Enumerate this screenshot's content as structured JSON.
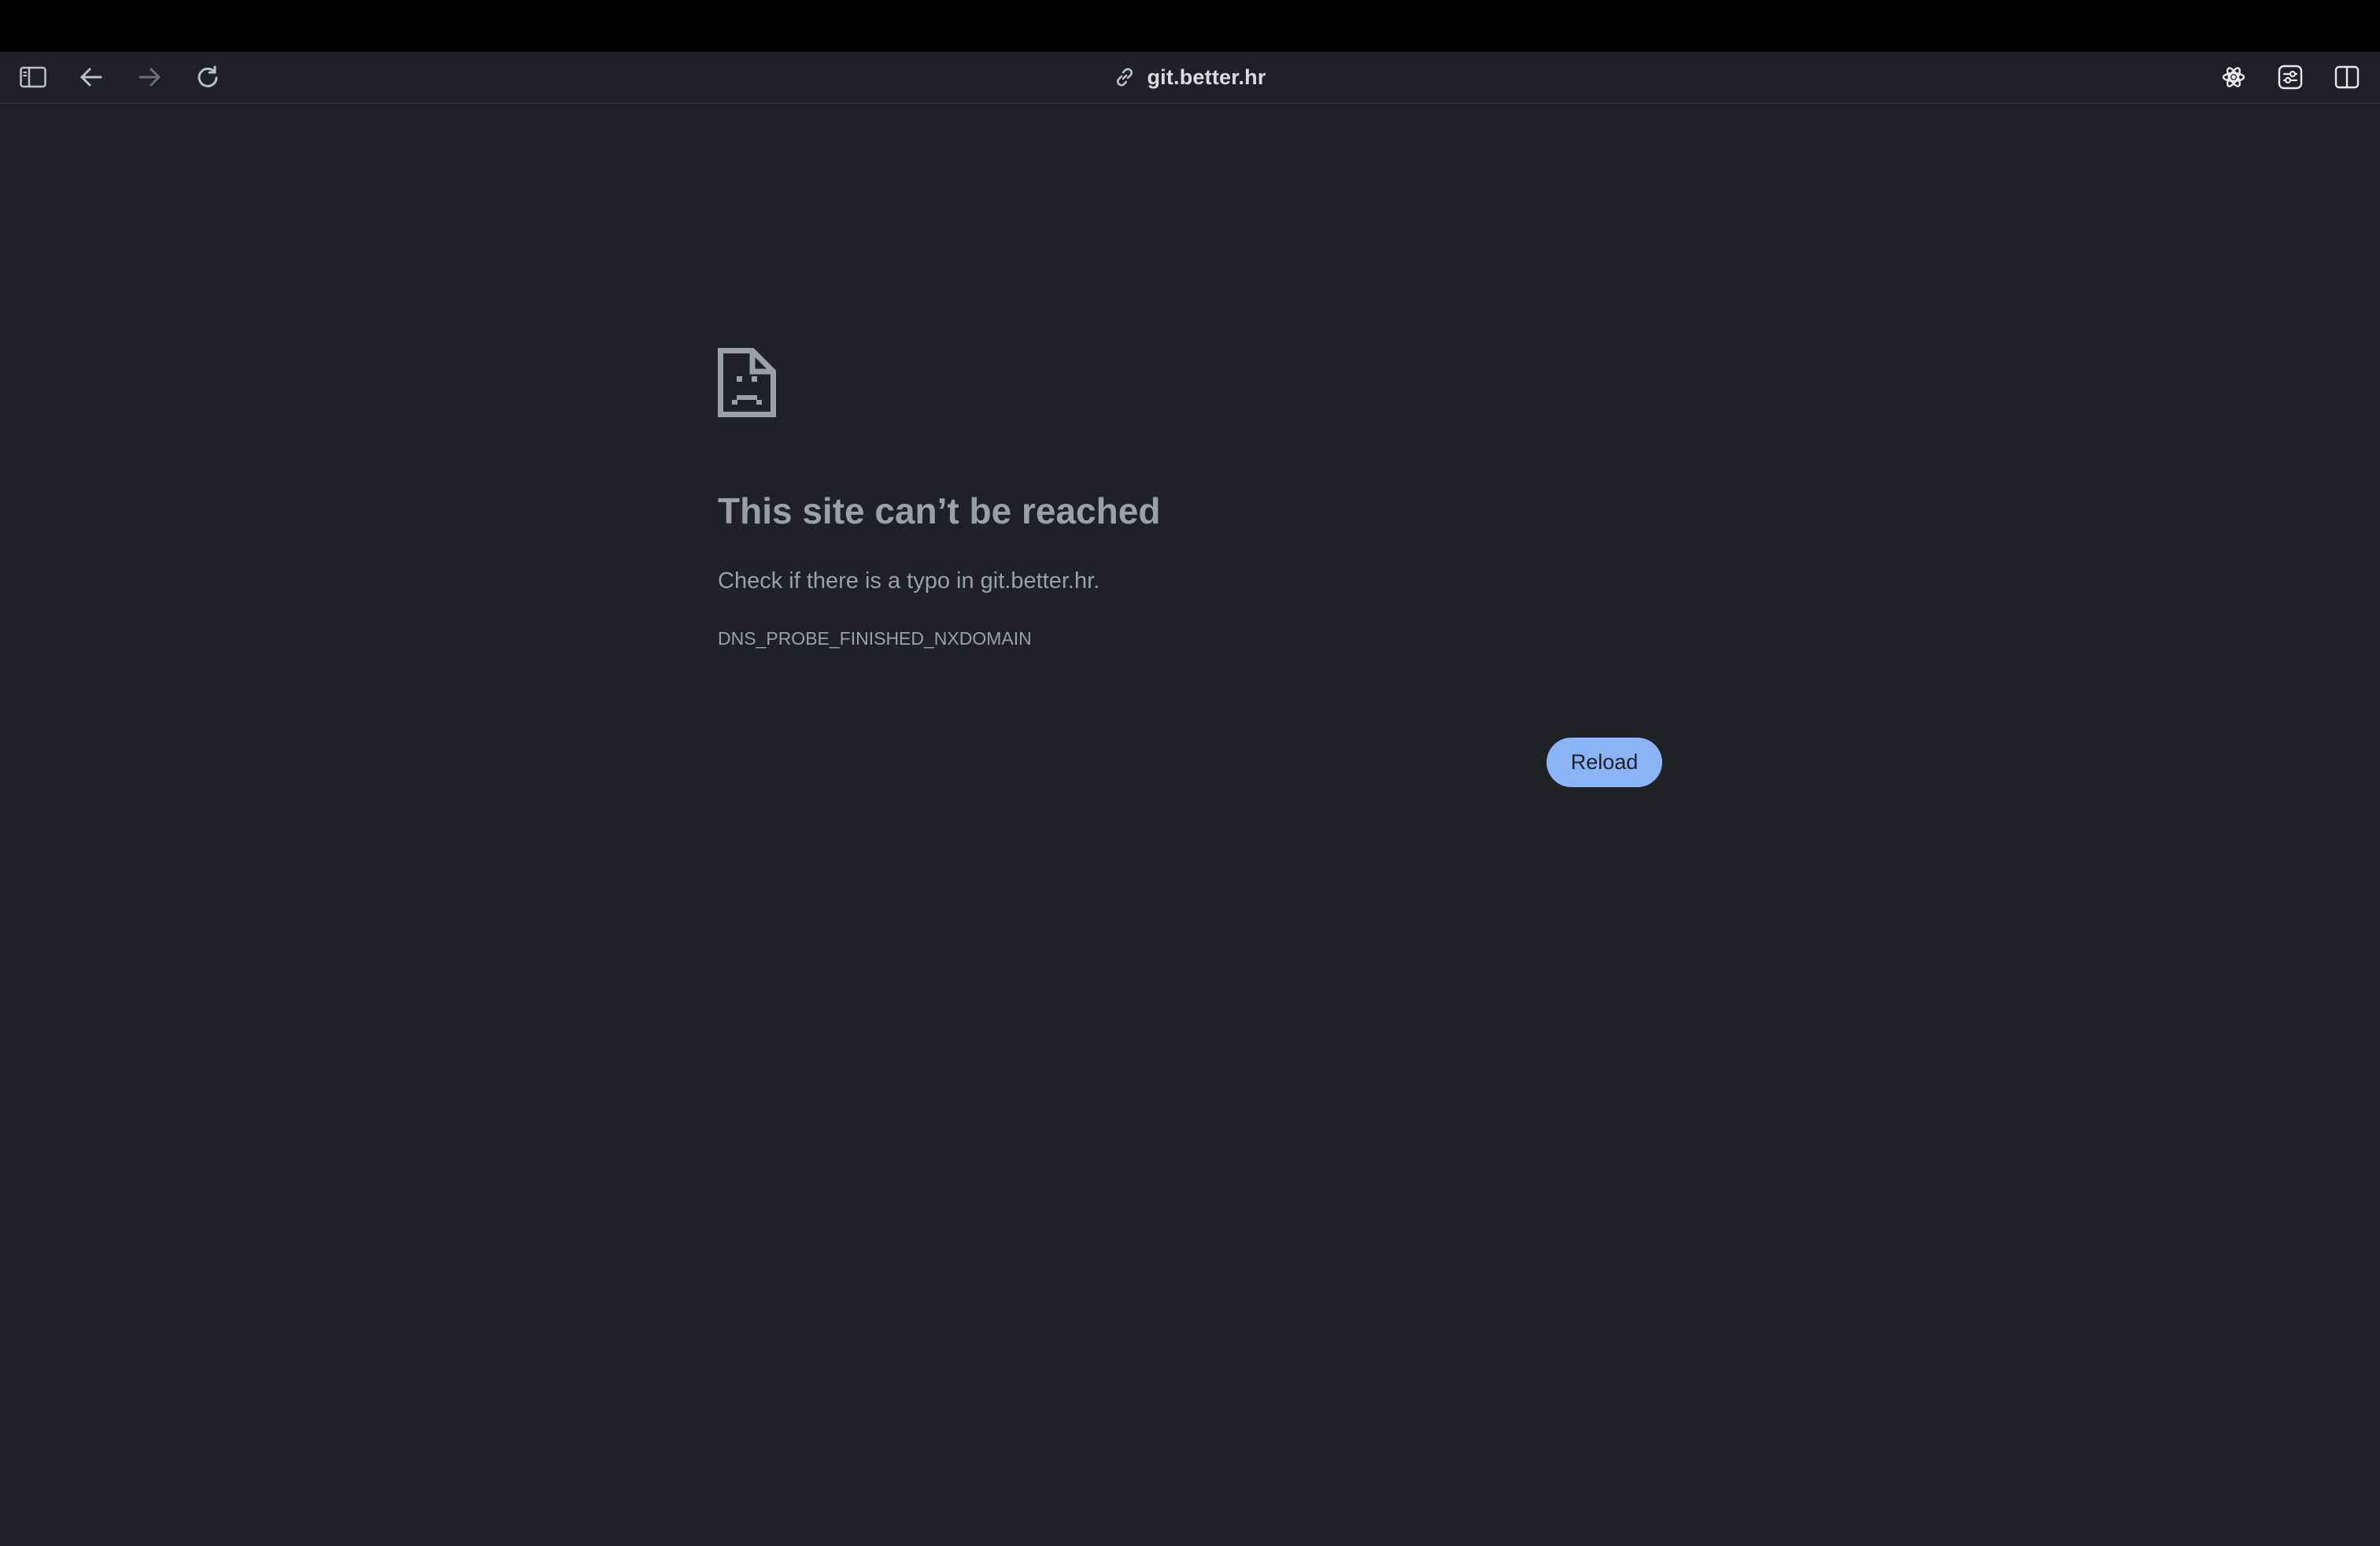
{
  "browser": {
    "address_bar": {
      "url": "git.better.hr",
      "icon": "link-icon"
    },
    "toolbar_icons": {
      "left": [
        "sidebar-toggle-icon",
        "back-arrow-icon",
        "forward-arrow-icon",
        "reload-icon"
      ],
      "right": [
        "atom-extension-icon",
        "extension-toggle-icon",
        "split-view-icon"
      ]
    }
  },
  "error_page": {
    "icon": "sad-document-icon",
    "title": "This site can’t be reached",
    "message": "Check if there is a typo in git.better.hr.",
    "error_code": "DNS_PROBE_FINISHED_NXDOMAIN",
    "reload_label": "Reload"
  },
  "colors": {
    "background": "#202124",
    "menubar": "#000000",
    "text": "#9aa0a6",
    "button": "#8ab4f8"
  }
}
